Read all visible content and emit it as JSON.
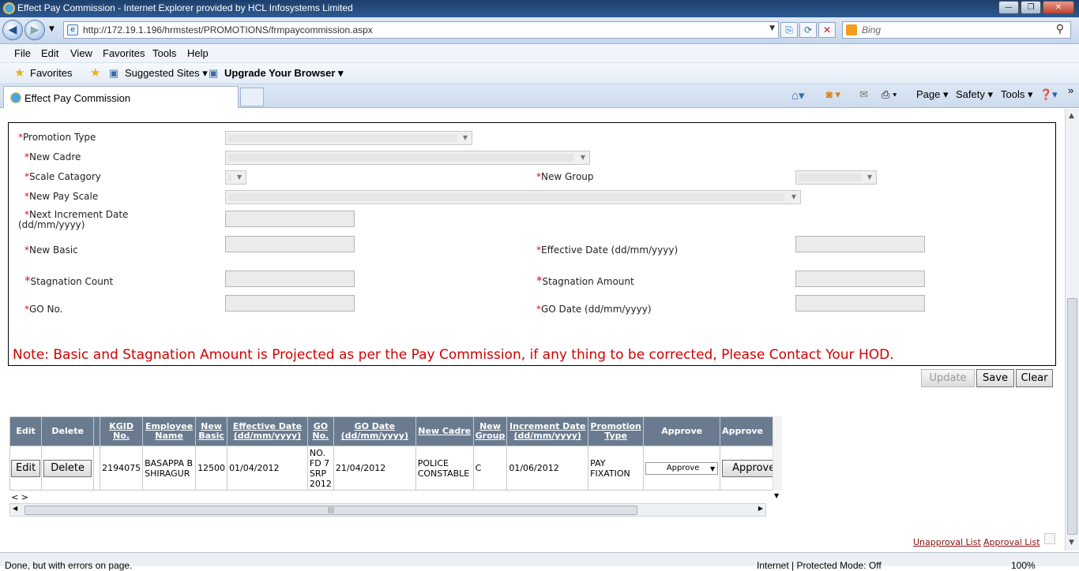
{
  "window": {
    "title": "Effect Pay Commission - Internet Explorer provided by HCL Infosystems Limited",
    "minimize": "—",
    "maximize": "❐",
    "close": "✕"
  },
  "address": {
    "url": "http://172.19.1.196/hrmstest/PROMOTIONS/frmpaycommission.aspx",
    "search_placeholder": "Bing"
  },
  "menu": {
    "file": "File",
    "edit": "Edit",
    "view": "View",
    "favorites": "Favorites",
    "tools": "Tools",
    "help": "Help"
  },
  "favbar": {
    "favorites": "Favorites",
    "suggested": "Suggested Sites ▾",
    "upgrade": "Upgrade Your Browser ▾"
  },
  "tab": {
    "label": "Effect Pay Commission"
  },
  "commands": {
    "page": "Page ▾",
    "safety": "Safety ▾",
    "tools": "Tools ▾"
  },
  "form": {
    "required_mark": "*",
    "promotion_type": "Promotion Type",
    "new_cadre": "New Cadre",
    "scale_category": "Scale Catagory",
    "new_group": "New Group",
    "new_pay_scale": "New Pay Scale",
    "next_increment_date": "Next Increment Date",
    "next_increment_date_fmt": "(dd/mm/yyyy)",
    "new_basic": "New Basic",
    "effective_date": "Effective Date (dd/mm/yyyy)",
    "stagnation_count": "Stagnation Count",
    "stagnation_amount": "Stagnation Amount",
    "go_no": "GO No.",
    "go_date": "GO Date (dd/mm/yyyy)",
    "note": "Note: Basic and Stagnation Amount is Projected as per the Pay Commission, if any thing to be corrected, Please Contact Your HOD."
  },
  "buttons": {
    "update": "Update",
    "save": "Save",
    "clear": "Clear"
  },
  "grid": {
    "headers": {
      "edit": "Edit",
      "delete": "Delete",
      "kgid": "KGID No.",
      "employee": "Employee Name",
      "new_basic": "New Basic",
      "effective_date": "Effective Date (dd/mm/yyyy)",
      "go_no": "GO No.",
      "go_date": "GO Date (dd/mm/yyyy)",
      "new_cadre": "New Cadre",
      "new_group": "New Group",
      "increment_date": "Increment Date (dd/mm/yyyy)",
      "promotion_type": "Promotion Type",
      "approve": "Approve",
      "approve2": "Approve"
    },
    "row": {
      "edit": "Edit",
      "delete": "Delete",
      "kgid": "2194075",
      "employee": "BASAPPA B SHIRAGUR",
      "new_basic": "12500",
      "effective_date": "01/04/2012",
      "go_no": "NO. FD 7 SRP 2012",
      "go_date": "21/04/2012",
      "new_cadre": "POLICE CONSTABLE",
      "new_group": "C",
      "increment_date": "01/06/2012",
      "promotion_type": "PAY FIXATION",
      "approve_select": "Approve",
      "approve_button": "Approve"
    },
    "pager": "< >"
  },
  "links": {
    "unapproval": "Unapproval List",
    "approval": "Approval List"
  },
  "status": {
    "left": "Done, but with errors on page.",
    "zone": "Internet | Protected Mode: Off",
    "zoom": "100%"
  }
}
